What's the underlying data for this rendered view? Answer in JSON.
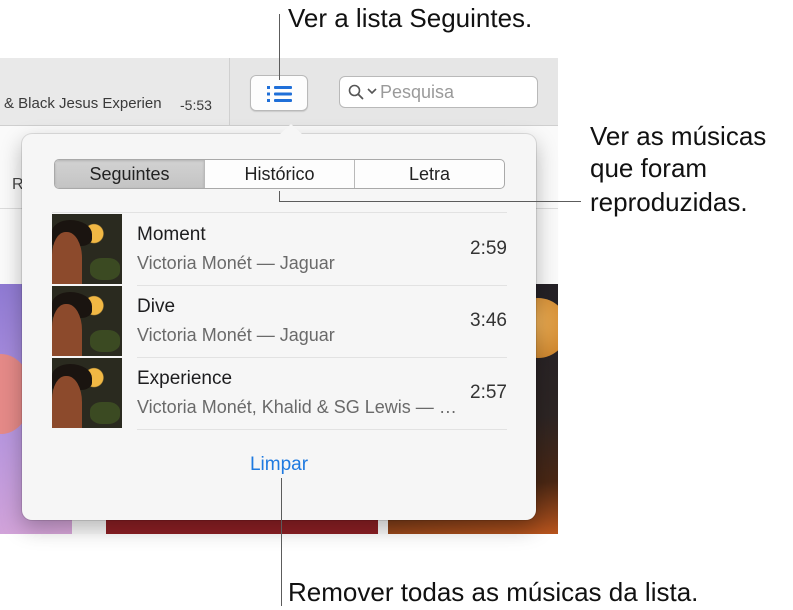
{
  "callouts": {
    "up_next": "Ver a lista Seguintes.",
    "history_line1": "Ver as músicas",
    "history_line2": "que foram",
    "history_line3": "reproduzidas.",
    "clear": "Remover todas as músicas da lista."
  },
  "toolbar": {
    "now_playing": "& Black Jesus Experien",
    "remaining_time": "-5:53",
    "search_placeholder": "Pesquisa"
  },
  "background": {
    "section_fragment": "Rec"
  },
  "popover": {
    "tabs": [
      {
        "label": "Seguintes",
        "active": true
      },
      {
        "label": "Histórico",
        "active": false
      },
      {
        "label": "Letra",
        "active": false
      }
    ],
    "songs": [
      {
        "title": "Moment",
        "subtitle": "Victoria Monét — Jaguar",
        "duration": "2:59"
      },
      {
        "title": "Dive",
        "subtitle": "Victoria Monét — Jaguar",
        "duration": "3:46"
      },
      {
        "title": "Experience",
        "subtitle": "Victoria Monét, Khalid & SG Lewis — Jaguar",
        "duration": "2:57"
      }
    ],
    "clear_label": "Limpar"
  },
  "colors": {
    "accent": "#1f7ae0",
    "icon_blue": "#1f6fd8"
  },
  "icons": {
    "up_next": "numbered-list-icon",
    "search": "magnifier-icon",
    "search_menu": "chevron-down-icon"
  }
}
